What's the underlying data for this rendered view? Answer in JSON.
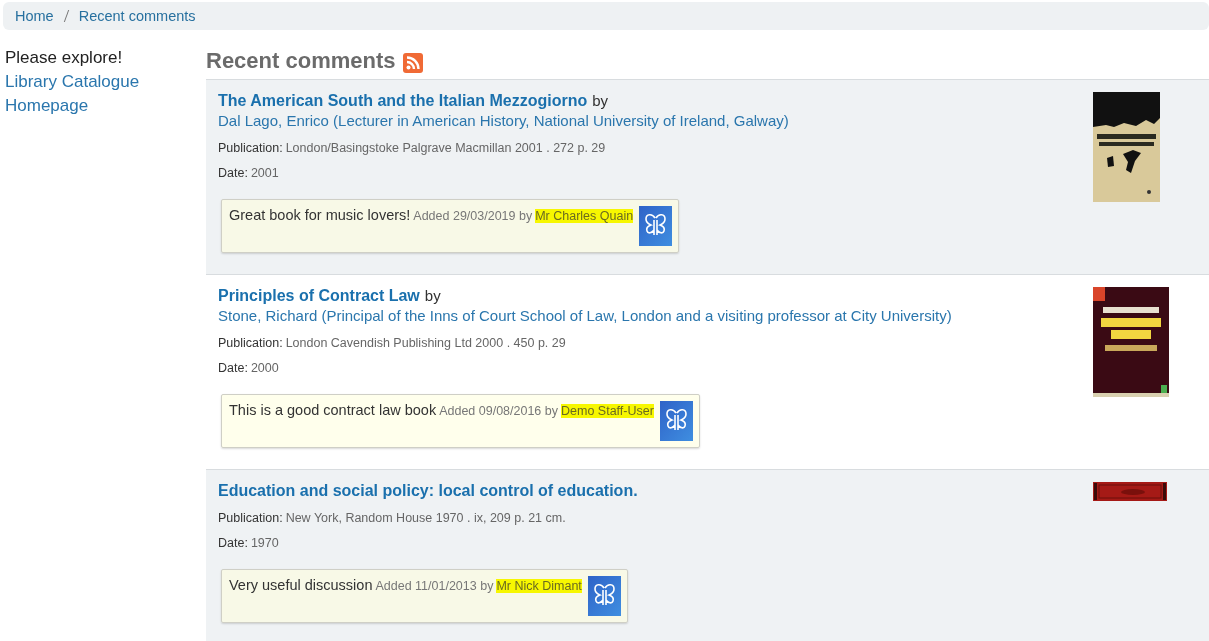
{
  "breadcrumb": [
    {
      "label": "Home"
    },
    {
      "label": "Recent comments"
    }
  ],
  "sidebar": {
    "intro": "Please explore!",
    "links": [
      {
        "label": "Library Catalogue"
      },
      {
        "label": "Homepage"
      }
    ]
  },
  "heading": "Recent comments",
  "comments": [
    {
      "title": "The American South and the Italian Mezzogiorno",
      "by": "by",
      "author": "Dal Lago, Enrico (Lecturer in American History, National University of Ireland, Galway)",
      "publication_label": "Publication:",
      "publication": "London/Basingstoke Palgrave Macmillan 2001 . 272 p. 29",
      "date_label": "Date:",
      "date": "2001",
      "comment": "Great book for music lovers!",
      "added": "Added 29/03/2019 by",
      "user": "Mr Charles Quain",
      "highlighted": true
    },
    {
      "title": "Principles of Contract Law",
      "by": "by",
      "author": "Stone, Richard (Principal of the Inns of Court School of Law, London and a visiting professor at City University)",
      "publication_label": "Publication:",
      "publication": "London Cavendish Publishing Ltd 2000 . 450 p. 29",
      "date_label": "Date:",
      "date": "2000",
      "comment": "This is a good contract law book",
      "added": "Added 09/08/2016 by",
      "user": "Demo Staff-User",
      "highlighted": true
    },
    {
      "title": "Education and social policy: local control of education.",
      "publication_label": "Publication:",
      "publication": "New York, Random House 1970 . ix, 209 p. 21 cm.",
      "date_label": "Date:",
      "date": "1970",
      "comment": "Very useful discussion",
      "added": "Added 11/01/2013 by",
      "user": "Mr Nick Dimant",
      "highlighted": true
    }
  ]
}
